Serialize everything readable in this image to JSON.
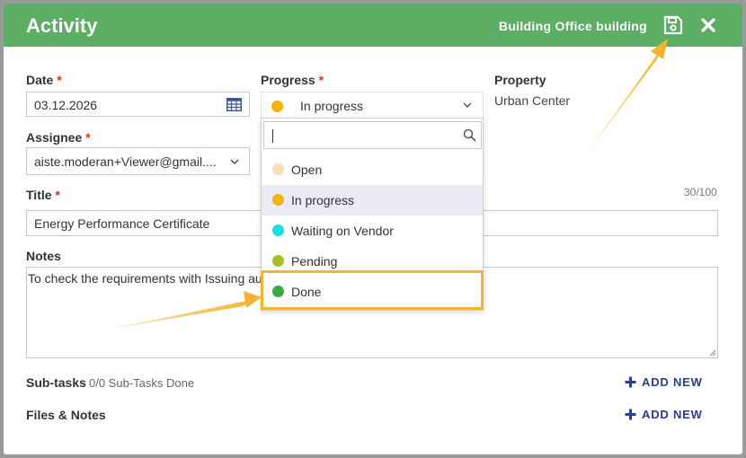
{
  "header": {
    "title": "Activity",
    "breadcrumb_prefix": "Building",
    "breadcrumb_name": "Office building",
    "bg_color": "#5cae64"
  },
  "form": {
    "date": {
      "label": "Date",
      "required": "*",
      "value": "03.12.2026"
    },
    "progress": {
      "label": "Progress",
      "required": "*",
      "value": "In progress",
      "value_color": "#f5b400"
    },
    "property": {
      "label": "Property",
      "value": "Urban Center"
    },
    "assignee": {
      "label": "Assignee",
      "required": "*",
      "value": "aiste.moderan+Viewer@gmail...."
    },
    "title": {
      "label": "Title",
      "required": "*",
      "value": "Energy Performance Certificate",
      "counter": "30/100"
    },
    "notes": {
      "label": "Notes",
      "value": "To check the requirements with Issuing au"
    },
    "subtasks": {
      "label": "Sub-tasks",
      "status": "0/0 Sub-Tasks Done",
      "add_label": "ADD NEW"
    },
    "files": {
      "label": "Files & Notes",
      "add_label": "ADD NEW"
    }
  },
  "progress_dropdown": {
    "search_placeholder": "",
    "options": [
      {
        "label": "Open",
        "color": "#f5deb3"
      },
      {
        "label": "In progress",
        "color": "#f5b400"
      },
      {
        "label": "Waiting on Vendor",
        "color": "#19dce6"
      },
      {
        "label": "Pending",
        "color": "#a8c020"
      },
      {
        "label": "Done",
        "color": "#3aa845"
      }
    ],
    "selected_index": 1,
    "highlighted_index": 4
  },
  "icons": {
    "save": "save-icon",
    "close": "close-icon",
    "calendar": "calendar-icon",
    "search": "search-icon",
    "chevron": "chevron-down-icon",
    "plus": "plus-icon"
  },
  "annotation_color": "#f3b531"
}
